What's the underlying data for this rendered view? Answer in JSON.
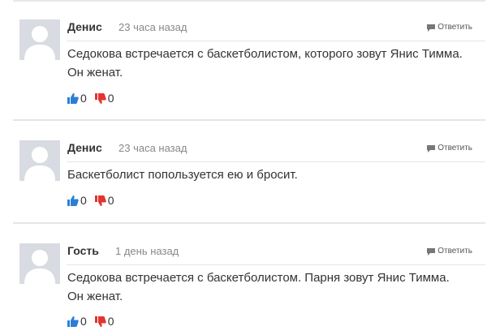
{
  "comments": [
    {
      "author": "Денис",
      "time": "23 часа назад",
      "reply_label": "Ответить",
      "text": "Седокова встречается с баскетболистом, которого зовут Янис Тимма. Он женат.",
      "likes": "0",
      "dislikes": "0"
    },
    {
      "author": "Денис",
      "time": "23 часа назад",
      "reply_label": "Ответить",
      "text": "Баскетболист попользуется ею и бросит.",
      "likes": "0",
      "dislikes": "0"
    },
    {
      "author": "Гость",
      "time": "1 день назад",
      "reply_label": "Ответить",
      "text": "Седокова встречается с баскетболистом. Парня зовут Янис Тимма. Он женат.",
      "likes": "0",
      "dislikes": "0"
    }
  ],
  "colors": {
    "like": "#2a7fd4",
    "dislike": "#e3342f",
    "avatar_bg": "#d9dbe3",
    "avatar_figure": "#ffffff"
  },
  "icons": {
    "avatar": "person-silhouette-icon",
    "reply": "speech-bubble-icon",
    "like": "thumbs-up-icon",
    "dislike": "thumbs-down-icon"
  }
}
